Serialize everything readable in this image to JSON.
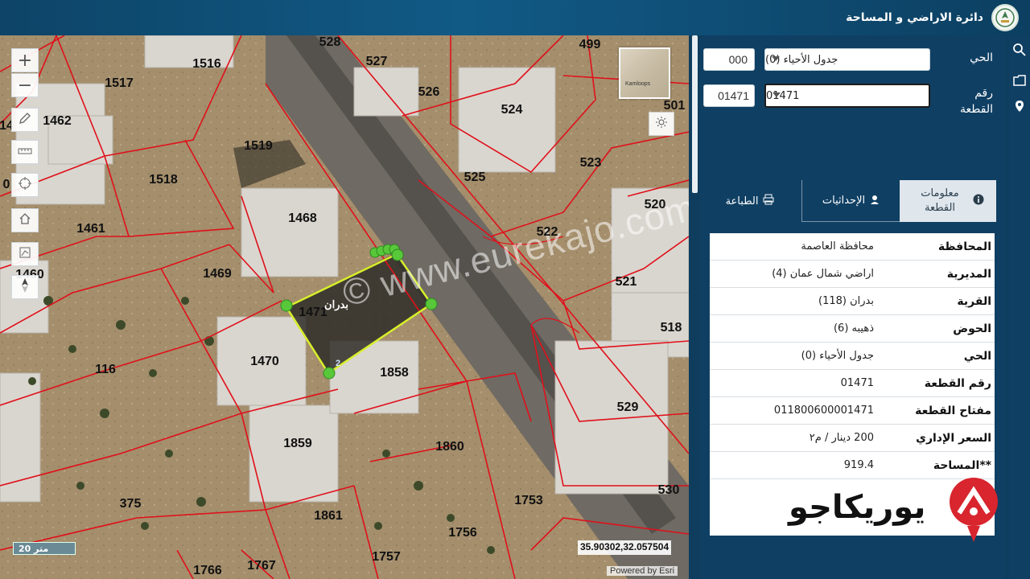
{
  "header": {
    "title": "دائرة الاراضي و المساحة",
    "logo_icon": "dls-emblem-icon"
  },
  "map": {
    "parcel_labels": [
      {
        "text": "528"
      },
      {
        "text": "527"
      },
      {
        "text": "526"
      },
      {
        "text": "499"
      },
      {
        "text": "501"
      },
      {
        "text": "1516"
      },
      {
        "text": "1517"
      },
      {
        "text": "1462"
      },
      {
        "text": "14"
      },
      {
        "text": "1519"
      },
      {
        "text": "1518"
      },
      {
        "text": "1461"
      },
      {
        "text": "1468"
      },
      {
        "text": "1469"
      },
      {
        "text": "1460"
      },
      {
        "text": "1471"
      },
      {
        "text": "1470"
      },
      {
        "text": "1858"
      },
      {
        "text": "116"
      },
      {
        "text": "1859"
      },
      {
        "text": "1860"
      },
      {
        "text": "375"
      },
      {
        "text": "1861"
      },
      {
        "text": "1753"
      },
      {
        "text": "1756"
      },
      {
        "text": "1757"
      },
      {
        "text": "1766"
      },
      {
        "text": "1767"
      },
      {
        "text": "524"
      },
      {
        "text": "525"
      },
      {
        "text": "523"
      },
      {
        "text": "520"
      },
      {
        "text": "522"
      },
      {
        "text": "521"
      },
      {
        "text": "518"
      },
      {
        "text": "529"
      },
      {
        "text": "530"
      },
      {
        "text": "2"
      },
      {
        "text": "0"
      }
    ],
    "selected_parcel_name": "بدران",
    "watermark": "© www.eurekajo.com",
    "scale_label": "20 متر",
    "coordinates": "35.90302,32.05750",
    "coordinates_suffix": "4",
    "attribution": "Powered by Esri",
    "basemap_label": "Kamloops",
    "controls": {
      "zoom_in": "+",
      "zoom_out": "−"
    }
  },
  "panel": {
    "district_label": "الحي",
    "district_code": "000",
    "district_select": "جدول الأحياء (0)",
    "parcel_no_label": "رقم القطعة",
    "parcel_no_code": "01471",
    "parcel_no_select": "01471",
    "tabs": [
      {
        "label": "معلومات القطعة",
        "icon": "info-icon"
      },
      {
        "label": "الإحداثيات",
        "icon": "pin-user-icon"
      },
      {
        "label": "الطباعة",
        "icon": "printer-icon"
      }
    ],
    "info_rows": [
      {
        "key": "المحافظة",
        "value": "محافظة العاصمة"
      },
      {
        "key": "المديرية",
        "value": "اراضي شمال عمان (4)"
      },
      {
        "key": "القرية",
        "value": "بدران (118)"
      },
      {
        "key": "الحوض",
        "value": "ذهيبه (6)"
      },
      {
        "key": "الحي",
        "value": "جدول الأحياء (0)"
      },
      {
        "key": "رقم القطعة",
        "value": "01471"
      },
      {
        "key": "مفتاح القطعة",
        "value": "011800600001471"
      },
      {
        "key": "السعر الإداري",
        "value": "200 دينار / م٢"
      },
      {
        "key": "**المساحة",
        "value": "919.4"
      }
    ]
  },
  "ad_overlay": {
    "text": "يوريكاجو"
  },
  "colors": {
    "header_bg": "#0d4467",
    "panel_bg": "#0f3f63",
    "parcel_line": "#e0101a",
    "selected_outline": "#d8ef2a"
  }
}
